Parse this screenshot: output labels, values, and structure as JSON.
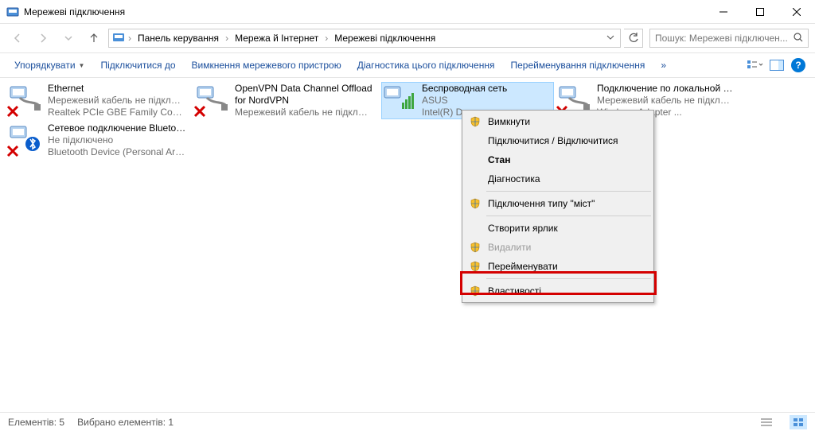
{
  "window": {
    "title": "Мережеві підключення"
  },
  "breadcrumb": {
    "items": [
      "Панель керування",
      "Мережа й Інтернет",
      "Мережеві підключення"
    ]
  },
  "search": {
    "placeholder": "Пошук: Мережеві підключен..."
  },
  "commands": {
    "organize": "Упорядкувати",
    "connect_to": "Підключитися до",
    "disable_device": "Вимкнення мережевого пристрою",
    "diagnose": "Діагностика цього підключення",
    "rename": "Перейменування підключення",
    "overflow": "»"
  },
  "connections": [
    {
      "name": "Ethernet",
      "status": "Мережевий кабель не підключ...",
      "device": "Realtek PCIe GBE Family Controller",
      "type": "eth",
      "overlay": "x"
    },
    {
      "name": "OpenVPN Data Channel Offload for NordVPN",
      "status": "Мережевий кабель не підключ...",
      "device": "",
      "type": "eth",
      "overlay": "x"
    },
    {
      "name": "Беспроводная сеть",
      "status": "ASUS",
      "device": "Intel(R) Du",
      "type": "wifi",
      "overlay": ""
    },
    {
      "name": "Подключение по локальной сети",
      "status": "Мережевий кабель не підключ...",
      "device": "Windows Adapter ...",
      "type": "eth",
      "overlay": "x"
    },
    {
      "name": "Сетевое подключение Bluetooth",
      "status": "Не підключено",
      "device": "Bluetooth Device (Personal Area ...",
      "type": "bt",
      "overlay": "x"
    }
  ],
  "context_menu": {
    "disable": "Вимкнути",
    "connect_disconnect": "Підключитися / Відключитися",
    "status": "Стан",
    "diagnose": "Діагностика",
    "bridge": "Підключення типу \"міст\"",
    "create_shortcut": "Створити ярлик",
    "delete": "Видалити",
    "rename": "Перейменувати",
    "properties": "Властивості"
  },
  "statusbar": {
    "items": "Елементів: 5",
    "selected": "Вибрано елементів: 1"
  }
}
